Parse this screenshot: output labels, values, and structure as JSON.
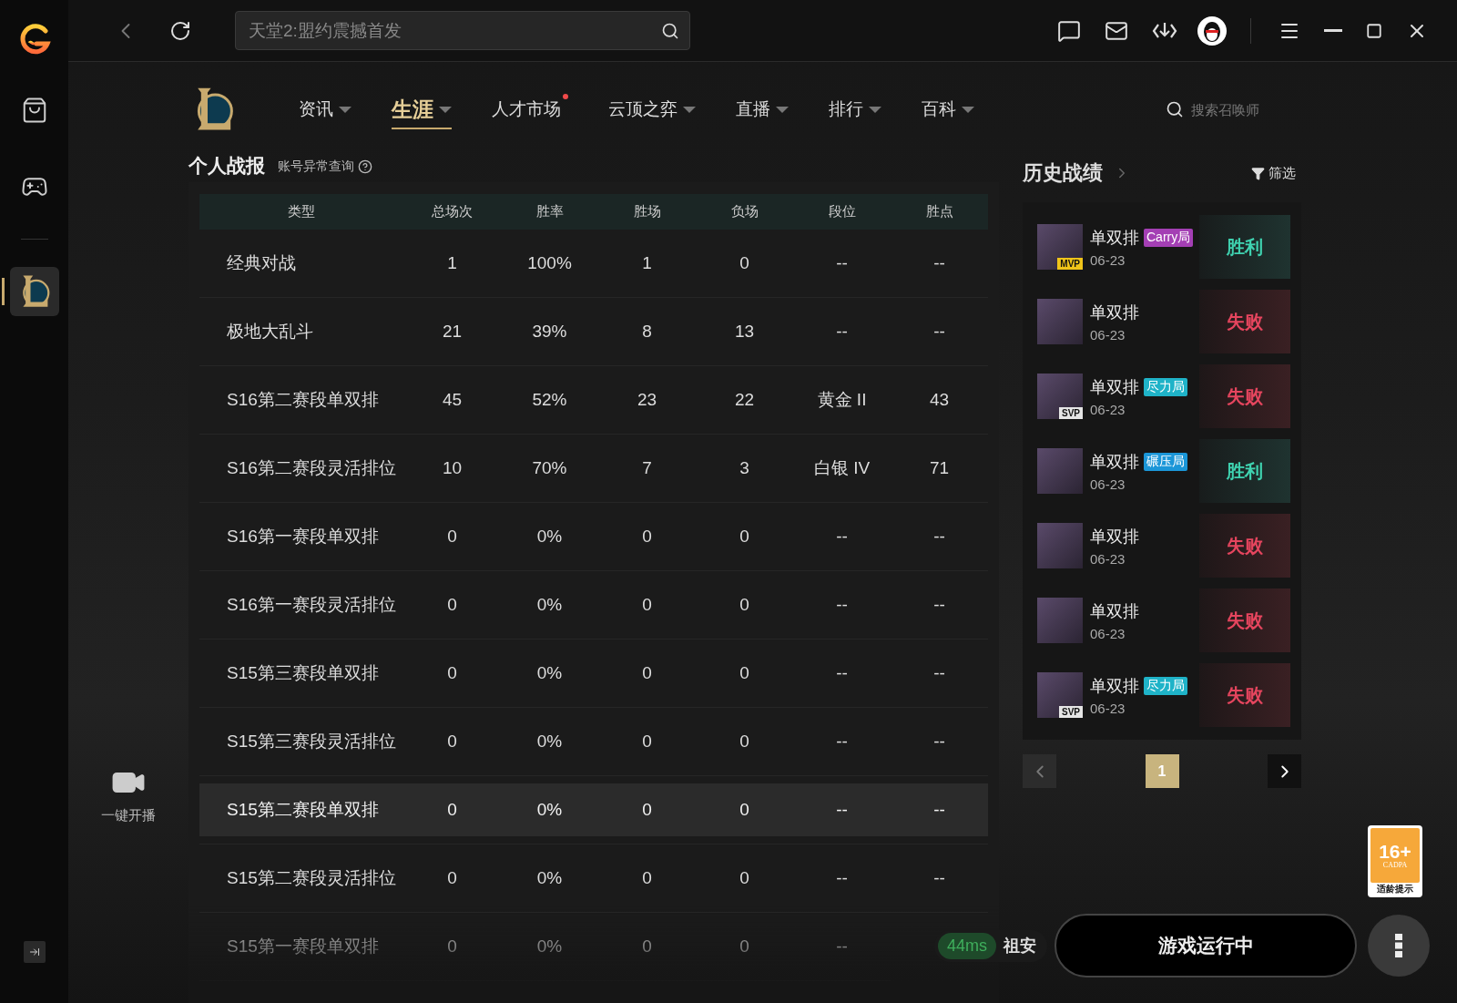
{
  "topbar": {
    "search": {
      "placeholder": "天堂2:盟约震撼首发"
    }
  },
  "sidebar": {
    "items": [
      {
        "kind": "store",
        "selected": false
      },
      {
        "kind": "games",
        "selected": false
      },
      {
        "kind": "lol",
        "selected": true
      }
    ],
    "live_label": "一键开播"
  },
  "nav": {
    "items": [
      {
        "label": "资讯",
        "selected": false,
        "has_menu": true,
        "dot": false
      },
      {
        "label": "生涯",
        "selected": true,
        "has_menu": true,
        "dot": false
      },
      {
        "label": "人才市场",
        "selected": false,
        "has_menu": false,
        "dot": true
      },
      {
        "label": "云顶之弈",
        "selected": false,
        "has_menu": true,
        "dot": false
      },
      {
        "label": "直播",
        "selected": false,
        "has_menu": true,
        "dot": false
      },
      {
        "label": "排行",
        "selected": false,
        "has_menu": true,
        "dot": false
      },
      {
        "label": "百科",
        "selected": false,
        "has_menu": true,
        "dot": false
      }
    ],
    "search": {
      "placeholder": "搜索召唤师"
    }
  },
  "stats": {
    "title": "个人战报",
    "link": "账号异常查询",
    "columns": [
      "类型",
      "总场次",
      "胜率",
      "胜场",
      "负场",
      "段位",
      "胜点"
    ],
    "rows": [
      {
        "cells": [
          "经典对战",
          "1",
          "100%",
          "1",
          "0",
          "--",
          "--"
        ],
        "selected": false
      },
      {
        "cells": [
          "极地大乱斗",
          "21",
          "39%",
          "8",
          "13",
          "--",
          "--"
        ],
        "selected": false
      },
      {
        "cells": [
          "S16第二赛段单双排",
          "45",
          "52%",
          "23",
          "22",
          "黄金 II",
          "43"
        ],
        "selected": false
      },
      {
        "cells": [
          "S16第二赛段灵活排位",
          "10",
          "70%",
          "7",
          "3",
          "白银 IV",
          "71"
        ],
        "selected": false
      },
      {
        "cells": [
          "S16第一赛段单双排",
          "0",
          "0%",
          "0",
          "0",
          "--",
          "--"
        ],
        "selected": false
      },
      {
        "cells": [
          "S16第一赛段灵活排位",
          "0",
          "0%",
          "0",
          "0",
          "--",
          "--"
        ],
        "selected": false
      },
      {
        "cells": [
          "S15第三赛段单双排",
          "0",
          "0%",
          "0",
          "0",
          "--",
          "--"
        ],
        "selected": false
      },
      {
        "cells": [
          "S15第三赛段灵活排位",
          "0",
          "0%",
          "0",
          "0",
          "--",
          "--"
        ],
        "selected": false
      },
      {
        "cells": [
          "S15第二赛段单双排",
          "0",
          "0%",
          "0",
          "0",
          "--",
          "--"
        ],
        "selected": true
      },
      {
        "cells": [
          "S15第二赛段灵活排位",
          "0",
          "0%",
          "0",
          "0",
          "--",
          "--"
        ],
        "selected": false
      },
      {
        "cells": [
          "S15第一赛段单双排",
          "0",
          "0%",
          "0",
          "0",
          "--"
        ],
        "selected": false
      }
    ]
  },
  "history": {
    "title": "历史战绩",
    "filter": "筛选",
    "matches": [
      {
        "badge": "MVP",
        "mode": "单双排",
        "tag": "Carry局",
        "color": "#a43fb4",
        "date": "06-23",
        "result": "胜利",
        "kind": "win"
      },
      {
        "mode": "单双排",
        "date": "06-23",
        "result": "失败",
        "kind": "loss"
      },
      {
        "badge": "SVP",
        "mode": "单双排",
        "tag": "尽力局",
        "color": "#1fb3c8",
        "date": "06-23",
        "result": "失败",
        "kind": "loss"
      },
      {
        "mode": "单双排",
        "tag": "碾压局",
        "color": "#1b96d8",
        "date": "06-23",
        "result": "胜利",
        "kind": "win"
      },
      {
        "mode": "单双排",
        "date": "06-23",
        "result": "失败",
        "kind": "loss"
      },
      {
        "mode": "单双排",
        "date": "06-23",
        "result": "失败",
        "kind": "loss"
      },
      {
        "badge": "SVP",
        "mode": "单双排",
        "tag": "尽力局",
        "color": "#1fb3c8",
        "date": "06-23",
        "result": "失败",
        "kind": "loss"
      }
    ],
    "pages": [
      {
        "label": "1",
        "selected": true
      }
    ]
  },
  "age_rating": {
    "rating": "16+",
    "org": "CADPA",
    "caption": "适龄提示"
  },
  "status": {
    "ping": "44ms",
    "server": "祖安",
    "launch": "游戏运行中"
  }
}
